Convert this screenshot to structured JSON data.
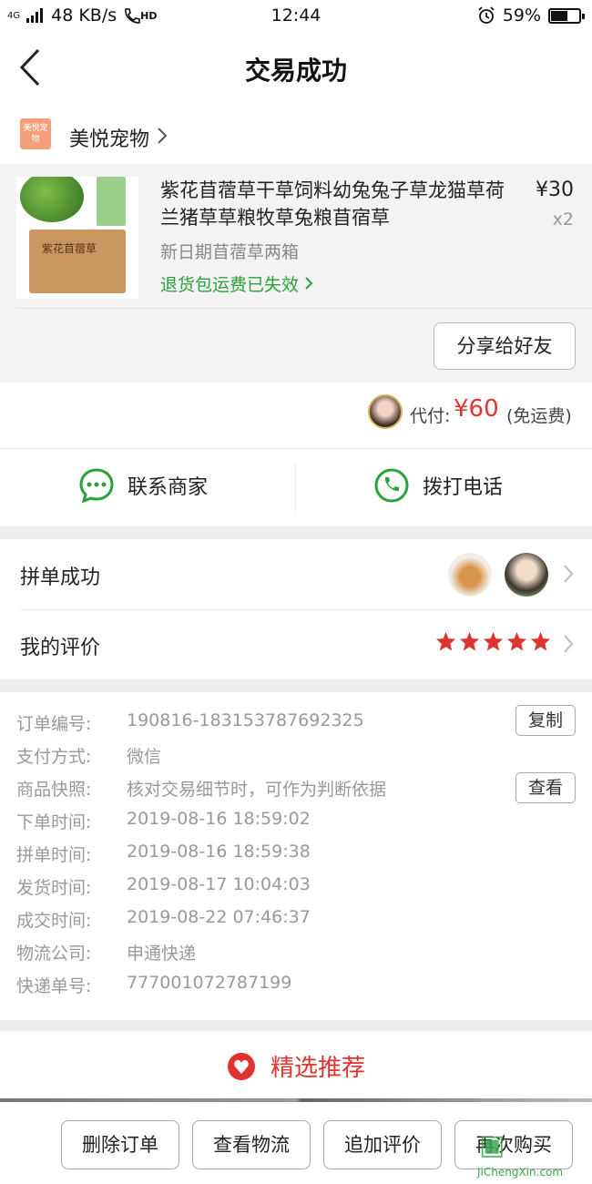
{
  "status": {
    "network": "4G",
    "speed": "48 KB/s",
    "hd": "HD",
    "time": "12:44",
    "battery": "59%",
    "battery_level": 0.59
  },
  "nav": {
    "title": "交易成功"
  },
  "shop": {
    "logo_text": "美悦宠物",
    "name": "美悦宠物"
  },
  "product": {
    "name": "紫花苜蓿草干草饲料幼兔兔子草龙猫草荷兰猪草草粮牧草兔粮苜宿草",
    "price": "¥30",
    "qty": "x2",
    "spec": "新日期苜蓿草两箱",
    "refund_note": "退货包运费已失效",
    "box_label": "紫花苜蓿草",
    "share_button": "分享给好友"
  },
  "payment": {
    "label": "代付:",
    "amount": "¥60",
    "note": "(免运费)"
  },
  "contact": {
    "merchant": "联系商家",
    "call": "拨打电话"
  },
  "group": {
    "success_label": "拼单成功",
    "review_label": "我的评价",
    "rating": 5
  },
  "order_info": {
    "rows": [
      {
        "k": "订单编号:",
        "v": "190816-183153787692325"
      },
      {
        "k": "支付方式:",
        "v": "微信"
      },
      {
        "k": "商品快照:",
        "v": "核对交易细节时，可作为判断依据"
      },
      {
        "k": "下单时间:",
        "v": "2019-08-16 18:59:02"
      },
      {
        "k": "拼单时间:",
        "v": "2019-08-16 18:59:38"
      },
      {
        "k": "发货时间:",
        "v": "2019-08-17 10:04:03"
      },
      {
        "k": "成交时间:",
        "v": "2019-08-22 07:46:37"
      },
      {
        "k": "物流公司:",
        "v": "申通快递"
      },
      {
        "k": "快递单号:",
        "v": "777001072787199"
      }
    ],
    "copy_button": "复制",
    "view_button": "查看"
  },
  "recommend": {
    "title": "精选推荐"
  },
  "actions": {
    "delete": "删除订单",
    "logistics": "查看物流",
    "add_review": "追加评价",
    "rebuy": "再次购买"
  },
  "watermark": {
    "text": "JiChengXin.com"
  },
  "colors": {
    "accent_red": "#e0322e",
    "green": "#2aa23a",
    "star": "#e0322e"
  }
}
